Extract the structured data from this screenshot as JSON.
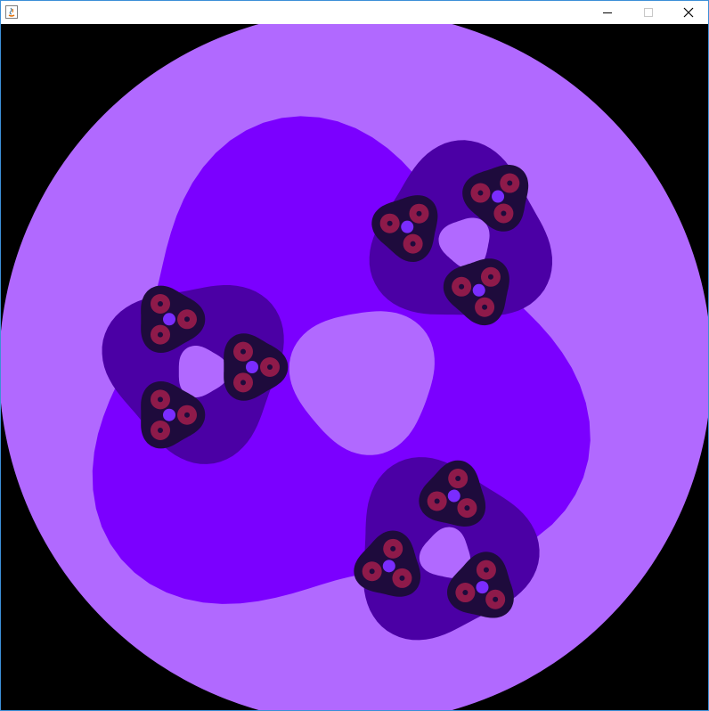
{
  "window": {
    "title": "",
    "app_icon": "java-icon",
    "controls": {
      "minimize_icon": "minimize-icon",
      "maximize_icon": "maximize-icon",
      "close_icon": "close-icon"
    }
  },
  "canvas": {
    "content": "fractal-render",
    "colors": {
      "background": "#000000",
      "outer_disk": "#b169ff",
      "level_1": "#7b00ff",
      "level_2": "#4b00a5",
      "level_3": "#1e0b3c",
      "level_4": "#8e1a4a",
      "accent_hole": "#7a2cff"
    }
  }
}
